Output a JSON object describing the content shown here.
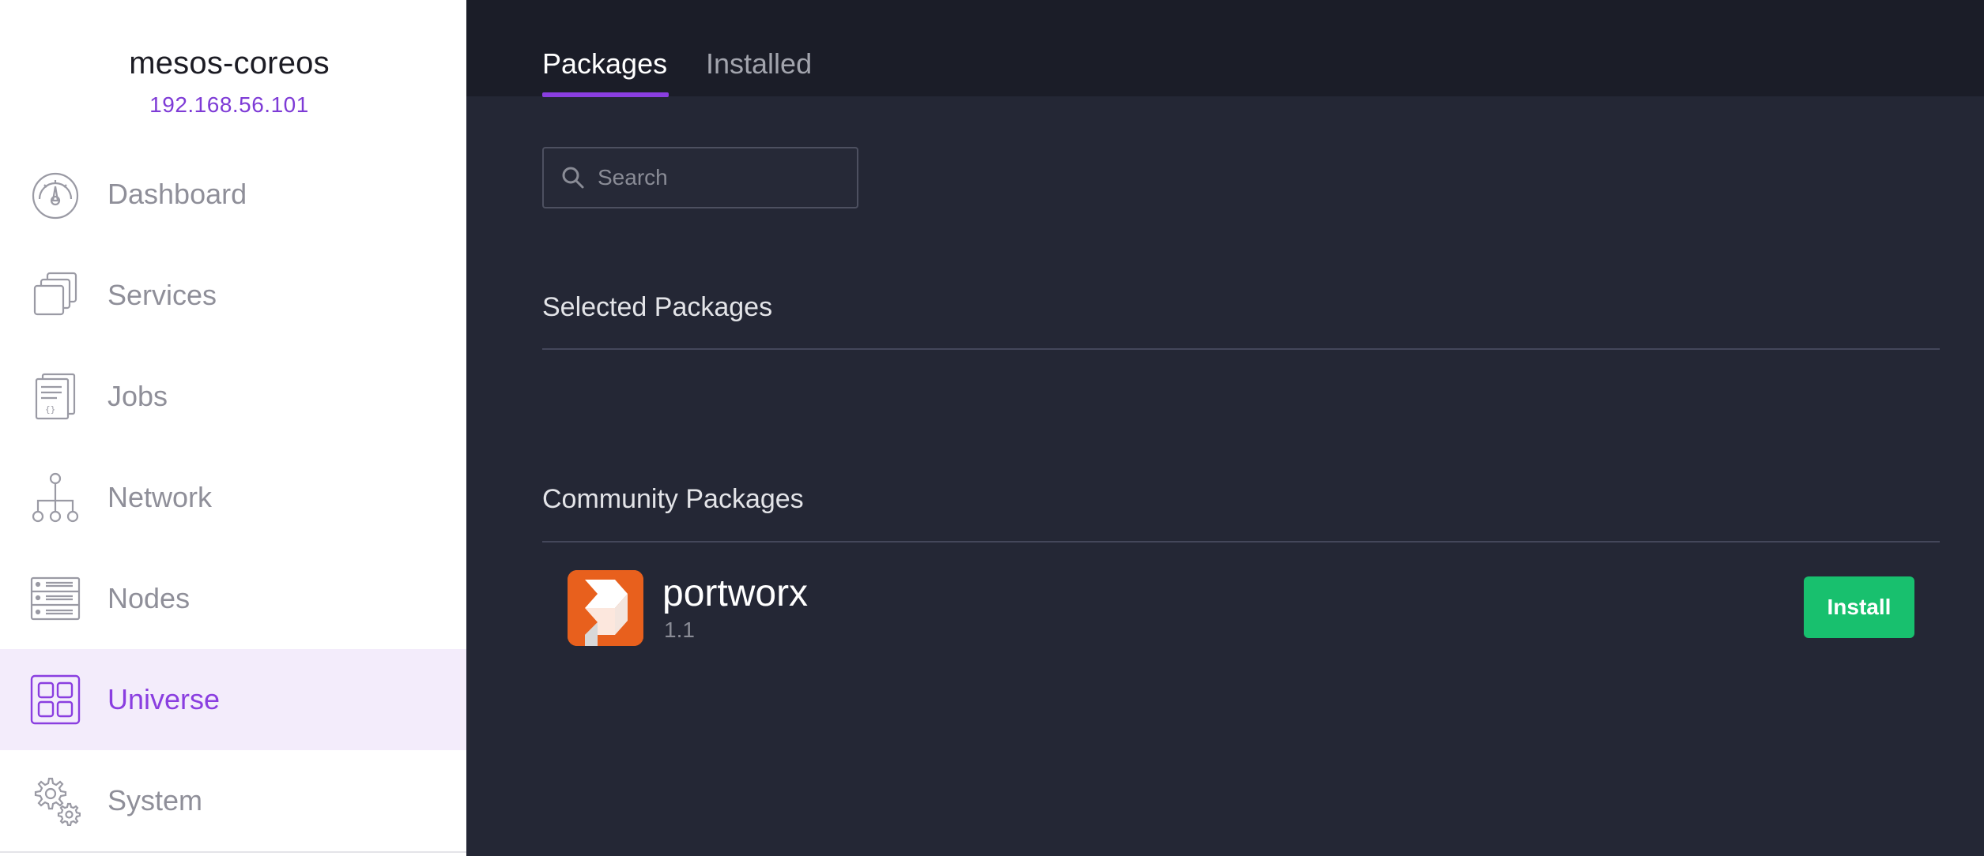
{
  "cluster": {
    "name": "mesos-coreos",
    "ip": "192.168.56.101"
  },
  "sidebar": {
    "items": [
      {
        "label": "Dashboard",
        "icon": "dashboard-gauge-icon",
        "active": false
      },
      {
        "label": "Services",
        "icon": "services-stack-icon",
        "active": false
      },
      {
        "label": "Jobs",
        "icon": "jobs-document-icon",
        "active": false
      },
      {
        "label": "Network",
        "icon": "network-tree-icon",
        "active": false
      },
      {
        "label": "Nodes",
        "icon": "nodes-server-icon",
        "active": false
      },
      {
        "label": "Universe",
        "icon": "universe-grid-icon",
        "active": true
      },
      {
        "label": "System",
        "icon": "system-gears-icon",
        "active": false
      }
    ]
  },
  "tabs": {
    "packages": "Packages",
    "installed": "Installed",
    "active": "Packages"
  },
  "search": {
    "placeholder": "Search",
    "value": ""
  },
  "sections": {
    "selected": "Selected Packages",
    "community": "Community Packages"
  },
  "packages": [
    {
      "name": "portworx",
      "version": "1.1",
      "action": "Install",
      "logo": "portworx-logo-icon"
    }
  ],
  "colors": {
    "accent": "#8a3ee0",
    "install": "#18c06e",
    "portworx": "#e8601d"
  }
}
